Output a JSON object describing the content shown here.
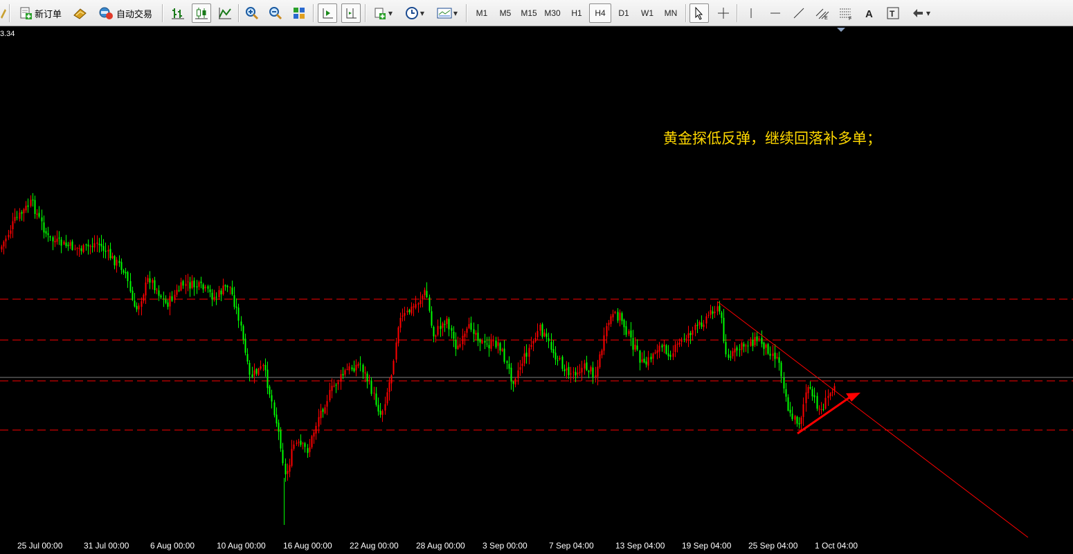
{
  "toolbar": {
    "new_order_label": "新订单",
    "auto_trade_label": "自动交易",
    "timeframes": [
      "M1",
      "M5",
      "M15",
      "M30",
      "H1",
      "H4",
      "D1",
      "W1",
      "MN"
    ],
    "active_timeframe": "H4"
  },
  "chart": {
    "price_label": "3.34",
    "annotation": "黄金探低反弹，继续回落补多单；",
    "time_labels": [
      "25 Jul 00:00",
      "31 Jul 00:00",
      "6 Aug 00:00",
      "10 Aug 00:00",
      "16 Aug 00:00",
      "22 Aug 00:00",
      "28 Aug 00:00",
      "3 Sep 00:00",
      "7 Sep 04:00",
      "13 Sep 04:00",
      "19 Sep 04:00",
      "25 Sep 04:00",
      "1 Oct 04:00"
    ],
    "colors": {
      "up": "#ff0000",
      "down": "#00ff00",
      "background": "#000000",
      "annotation": "#ffd800",
      "level_line": "#ff0000",
      "bid_line": "#808080"
    }
  }
}
